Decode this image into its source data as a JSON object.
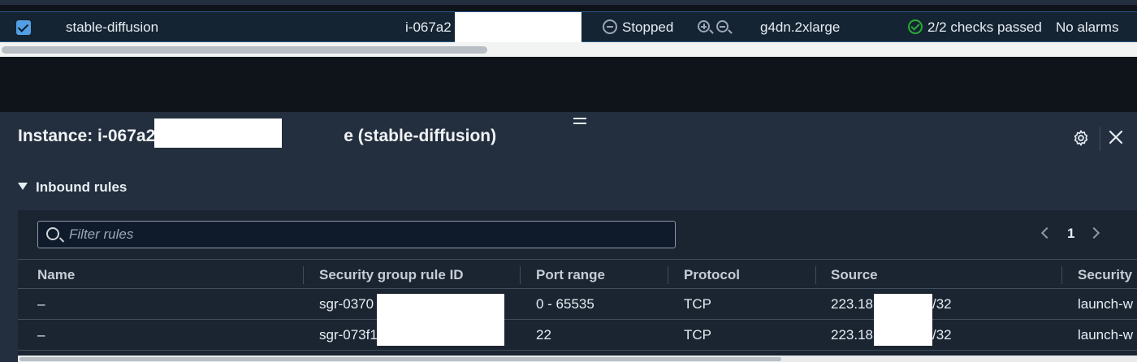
{
  "instance_row": {
    "name": "stable-diffusion",
    "instance_id": "i-067a2",
    "state": "Stopped",
    "instance_type": "g4dn.2xlarge",
    "status_check": "2/2 checks passed",
    "alarm_status": "No alarms"
  },
  "details_panel": {
    "title_prefix": "Instance: i-067a2",
    "title_suffix": "e (stable-diffusion)",
    "section_title": "Inbound rules",
    "filter_placeholder": "Filter rules",
    "page_number": "1",
    "columns": [
      "Name",
      "Security group rule ID",
      "Port range",
      "Protocol",
      "Source",
      "Security"
    ],
    "rows": [
      {
        "name": "–",
        "rule_id": "sgr-0370",
        "port_range": "0 - 65535",
        "protocol": "TCP",
        "source_start": "223.18",
        "source_end": "/32",
        "security_group": "launch-w"
      },
      {
        "name": "–",
        "rule_id": "sgr-073f1",
        "port_range": "22",
        "protocol": "TCP",
        "source_start": "223.18",
        "source_end": "/32",
        "security_group": "launch-w"
      }
    ]
  },
  "colors": {
    "link": "#539fe5",
    "success": "#29ad32",
    "panel_bg": "#232f3e",
    "selected_row_bg": "#152433"
  },
  "icons": [
    "checkbox-checked-icon",
    "stopped-icon",
    "zoom-in-icon",
    "zoom-out-icon",
    "check-circle-icon",
    "drag-handle-icon",
    "gear-icon",
    "close-icon",
    "caret-down-icon",
    "search-icon",
    "chevron-left-icon",
    "chevron-right-icon"
  ]
}
